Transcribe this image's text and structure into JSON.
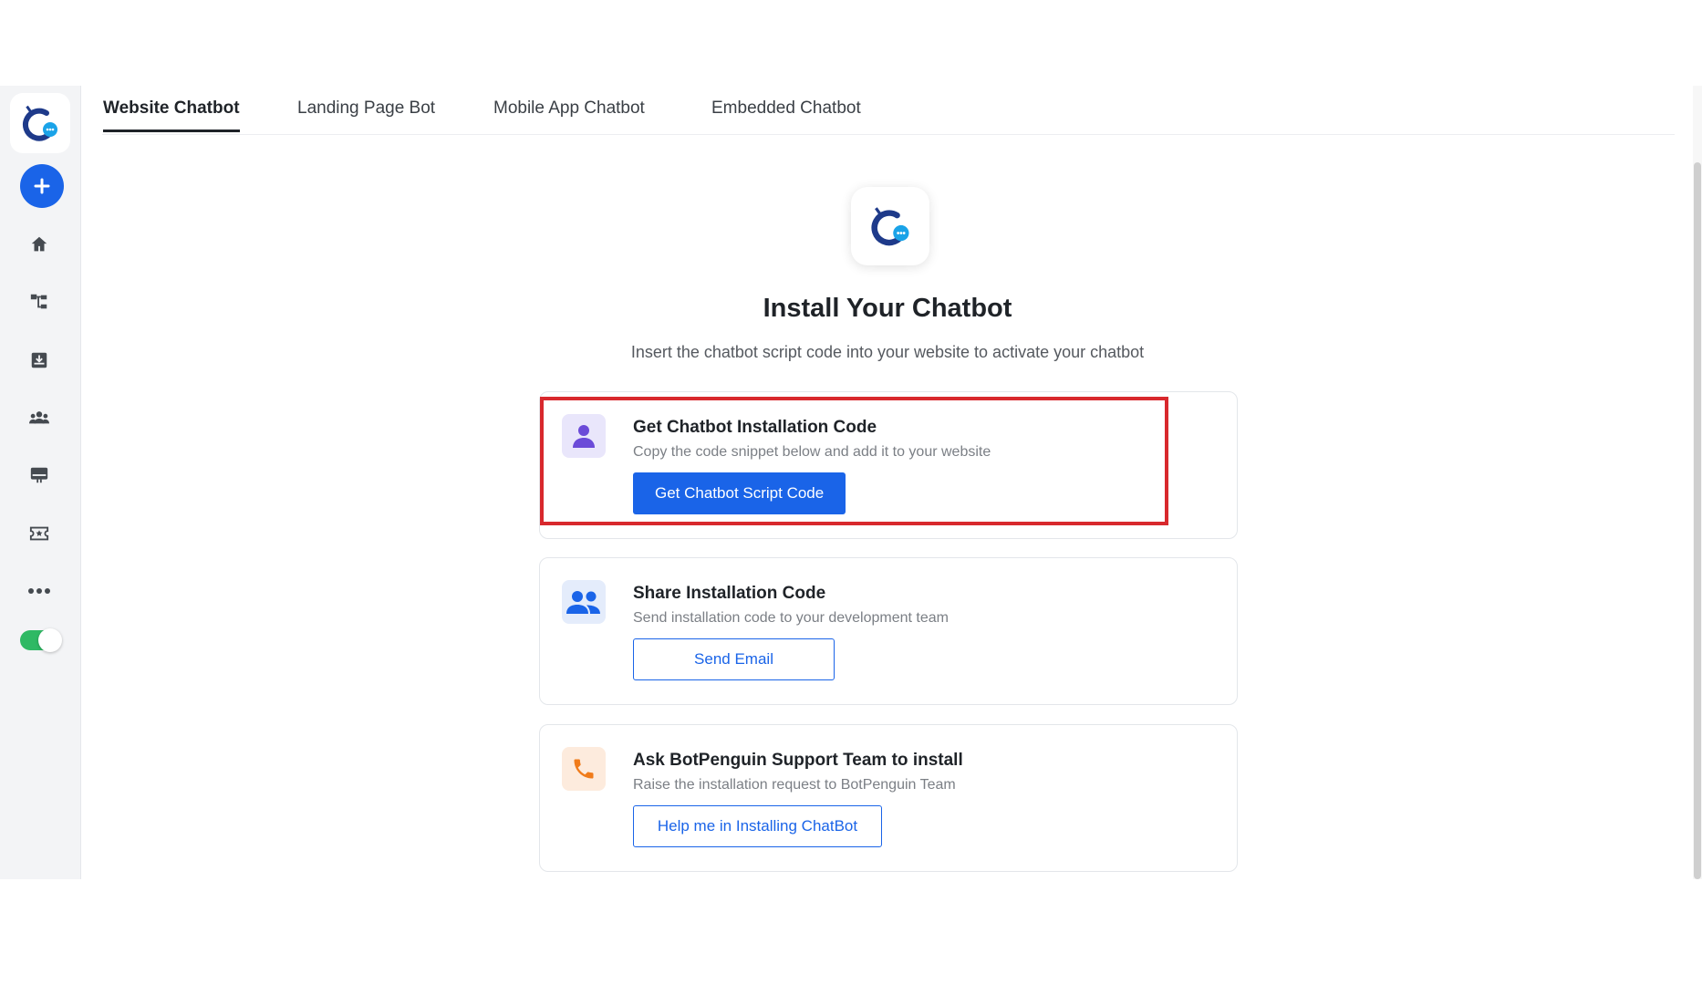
{
  "tabs": [
    {
      "label": "Website Chatbot",
      "active": true
    },
    {
      "label": "Landing Page Bot",
      "active": false
    },
    {
      "label": "Mobile App Chatbot",
      "active": false
    },
    {
      "label": "Embedded Chatbot",
      "active": false
    }
  ],
  "sidebar": {
    "logo_icon": "cube-chatbot-logo",
    "add_icon": "plus-icon",
    "items": [
      {
        "icon": "home-icon"
      },
      {
        "icon": "flow-icon"
      },
      {
        "icon": "inbox-icon"
      },
      {
        "icon": "users-icon"
      },
      {
        "icon": "monitor-icon"
      },
      {
        "icon": "ticket-icon"
      },
      {
        "icon": "more-icon"
      }
    ],
    "toggle_on": true
  },
  "main": {
    "title": "Install Your Chatbot",
    "subtitle": "Insert the chatbot script code into your website to activate your chatbot",
    "cards": [
      {
        "icon": "person-icon",
        "title": "Get Chatbot Installation Code",
        "description": "Copy the code snippet below and add it to your website",
        "button": "Get Chatbot Script Code"
      },
      {
        "icon": "team-icon",
        "title": "Share Installation Code",
        "description": "Send installation code to your development team",
        "button": "Send Email"
      },
      {
        "icon": "phone-icon",
        "title": "Ask BotPenguin Support Team to install",
        "description": "Raise the installation request to BotPenguin Team",
        "button": "Help me in Installing ChatBot"
      }
    ]
  },
  "colors": {
    "accent": "#1a64e8",
    "highlight": "#d8282d",
    "toggle": "#2fb964"
  }
}
